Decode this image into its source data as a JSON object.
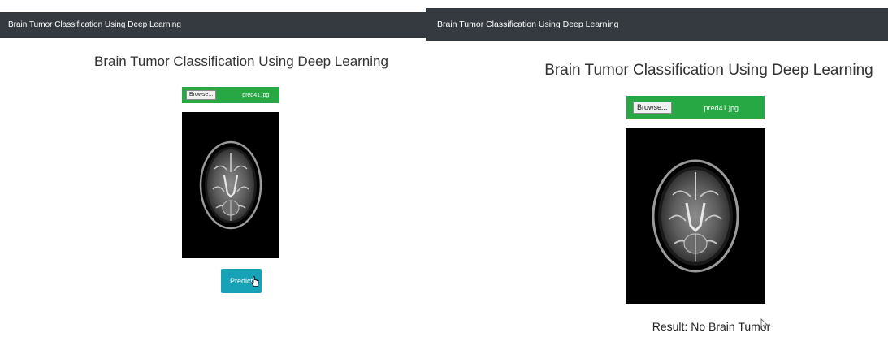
{
  "left": {
    "navbar_title": "Brain Tumor Classification Using Deep Learning",
    "page_title": "Brain Tumor Classification Using Deep Learning",
    "browse_label": "Browse...",
    "file_name": "pred41.jpg",
    "predict_label": "Predict"
  },
  "right": {
    "navbar_title": "Brain Tumor Classification Using Deep Learning",
    "page_title": "Brain Tumor Classification Using Deep Learning",
    "browse_label": "Browse...",
    "file_name": "pred41.jpg",
    "result": "Result: No Brain Tumor"
  },
  "colors": {
    "navbar": "#343a40",
    "upload_bar": "#28a745",
    "predict_button": "#17a2b8"
  },
  "icons": {
    "left_cursor": "hand-pointer-icon",
    "right_cursor": "arrow-pointer-icon"
  }
}
